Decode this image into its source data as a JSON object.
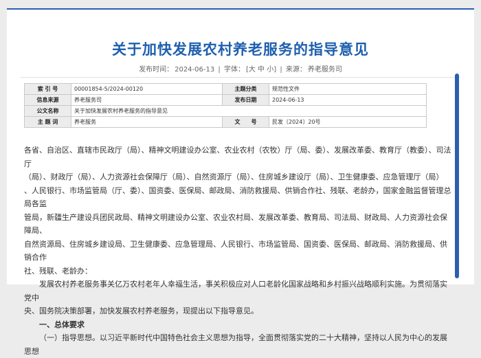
{
  "title": "关于加快发展农村养老服务的指导意见",
  "meta": {
    "date_label": "发布时间：",
    "date": "2024-06-13",
    "size_label": "字体：",
    "size_options": "[大 中 小]",
    "source_label": "来源：",
    "source": "养老服务司"
  },
  "info": {
    "index_label": "索 引 号",
    "index_value": "00001854-5/2024-00120",
    "category_label": "主题分类",
    "category_value": "规范性文件",
    "origin_label": "信息来源",
    "origin_value": "养老服务司",
    "date_label": "发布日期",
    "date_value": "2024-06-13",
    "doc_title_label": "公文名称",
    "doc_title_value": "关于加快发展农村养老服务的指导意见",
    "subject_label": "主 题 词",
    "subject_value": "养老服务",
    "docno_label": "文　　号",
    "docno_value": "民发〔2024〕20号"
  },
  "body": {
    "recipients_lines": [
      "各省、自治区、直辖市民政厅（局）、精神文明建设办公室、农业农村（农牧）厅（局、委）、发展改革委、教育厅（教委）、司法厅",
      "（局）、财政厅（局）、人力资源社会保障厅（局）、自然资源厅（局）、住房城乡建设厅（局）、卫生健康委、应急管理厅（局）",
      "、人民银行、市场监管局（厅、委）、国资委、医保局、邮政局、消防救援局、供销合作社、残联、老龄办，国家金融监督管理总局各监",
      "管局，新疆生产建设兵团民政局、精神文明建设办公室、农业农村局、发展改革委、教育局、司法局、财政局、人力资源社会保障局、",
      "自然资源局、住房城乡建设局、卫生健康委、应急管理局、人民银行、市场监管局、国资委、医保局、邮政局、消防救援局、供销合作",
      "社、残联、老龄办："
    ],
    "intro_lines": [
      "发展农村养老服务事关亿万农村老年人幸福生活，事关积极应对人口老龄化国家战略和乡村振兴战略顺利实施。为贯彻落实党中",
      "央、国务院决策部署，加快发展农村养老服务，现提出以下指导意见。"
    ],
    "section1": "一、总体要求",
    "section1_1": "（一）指导思想。以习近平新时代中国特色社会主义思想为指导，全面贯彻落实党的二十大精神，坚持以人民为中心的发展思想"
  }
}
